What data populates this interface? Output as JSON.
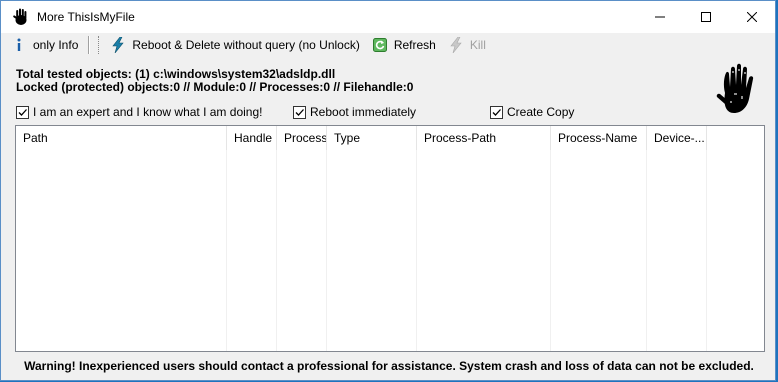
{
  "window": {
    "title": "More ThisIsMyFile",
    "controls": {
      "minimize": "minimize",
      "maximize": "maximize",
      "close": "close"
    }
  },
  "toolbar": {
    "only_info": "only Info",
    "reboot_delete": "Reboot & Delete without query (no Unlock)",
    "refresh": "Refresh",
    "kill": "Kill"
  },
  "info": {
    "line1": "Total tested objects: (1) c:\\windows\\system32\\adsldp.dll",
    "line2": "Locked (protected) objects:0  //  Module:0  //  Processes:0  //  Filehandle:0"
  },
  "options": {
    "expert": {
      "label": "I am an expert and I know what I am doing!",
      "checked": true
    },
    "reboot": {
      "label": "Reboot immediately",
      "checked": true
    },
    "copy": {
      "label": "Create Copy",
      "checked": true
    }
  },
  "list": {
    "columns": [
      "Path",
      "Handle",
      "Process",
      "Type",
      "Process-Path",
      "Process-Name",
      "Device-..."
    ],
    "rows": []
  },
  "warning": "Warning! Inexperienced users should contact a professional for assistance. System crash and loss of data can not be excluded.",
  "colors": {
    "desktop": "#1e73be",
    "window_bg": "#f0f0f0",
    "accent": "#3a9a3a",
    "kill_disabled": "#a0a0a0"
  }
}
